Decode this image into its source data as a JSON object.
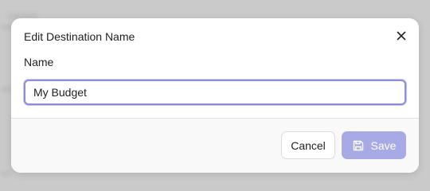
{
  "dialog": {
    "title": "Edit Destination Name",
    "name_label": "Name",
    "name_value": "My Budget",
    "close_icon": "close-icon"
  },
  "footer": {
    "cancel_label": "Cancel",
    "save_label": "Save",
    "save_icon": "floppy-disk-icon"
  },
  "colors": {
    "overlay": "#cacaca",
    "input_focus_border": "#8c8ed6",
    "save_button_disabled": "#a8aae6",
    "footer_bg": "#f9f9f9"
  }
}
